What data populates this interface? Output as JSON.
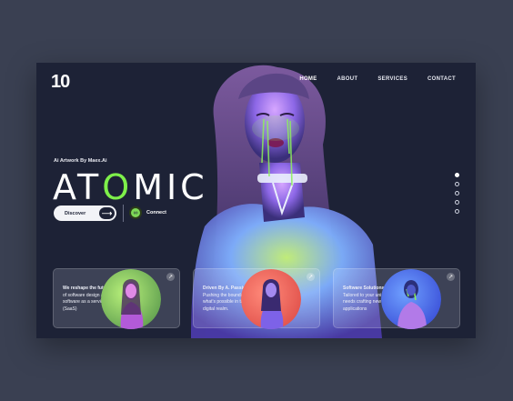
{
  "logo": "10",
  "nav": {
    "items": [
      "HOME",
      "ABOUT",
      "SERVICES",
      "CONTACT"
    ],
    "active": "HOME"
  },
  "hero": {
    "kicker": "Ai Artwork By Maex.Ai",
    "title_parts": [
      "AT",
      "O",
      "MIC"
    ],
    "title_badge": "1",
    "discover_label": "Discover",
    "arrow": "⟶",
    "connect_label": "Connect",
    "connect_icon": "∞"
  },
  "slides": {
    "count": 5,
    "active": 1
  },
  "cards": [
    {
      "heading": "We reshape the future",
      "body": "of software design and software as a service (SaaS)",
      "icon": "↗"
    },
    {
      "heading": "Driven By A. Passion:",
      "body": "Pushing the boundaries of what's possible in the digital realm.",
      "icon": "↗"
    },
    {
      "heading": "Software Solutions",
      "body": "Tailored to your unique needs crafting new applications",
      "icon": "↗"
    }
  ],
  "colors": {
    "background": "#3a4052",
    "frame": "#1d2236",
    "accent": "#7ef04a",
    "glow": "#b06cff"
  }
}
